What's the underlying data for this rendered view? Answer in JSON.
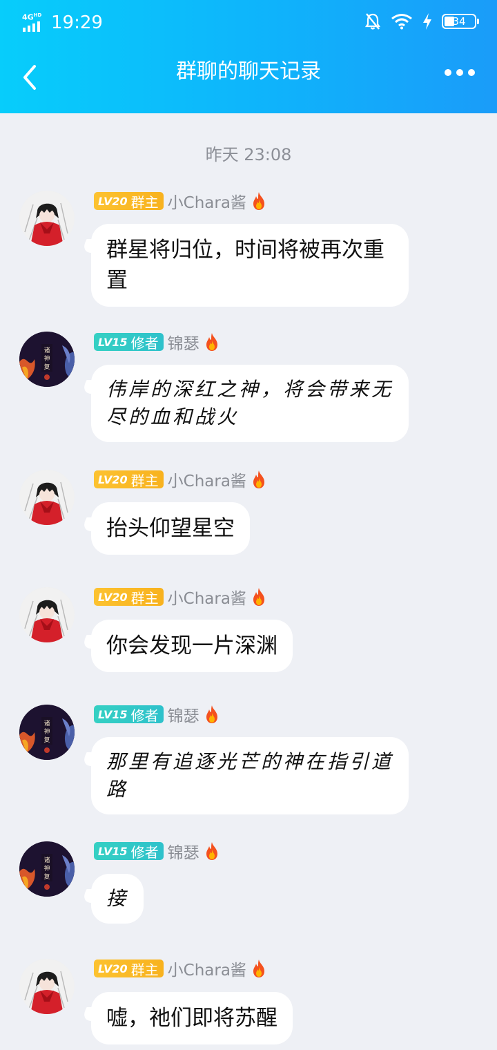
{
  "status_bar": {
    "network": "4G",
    "network_sup": "HD",
    "time": "19:29",
    "battery": "34"
  },
  "header": {
    "title": "群聊的聊天记录"
  },
  "timestamp": "昨天 23:08",
  "users": {
    "chara": {
      "level": "LV20",
      "role": "群主",
      "name": "小Chara酱"
    },
    "jinse": {
      "level": "LV15",
      "role": "修者",
      "name": "锦瑟"
    }
  },
  "messages": [
    {
      "user": "chara",
      "text": "群星将归位，时间将被再次重置"
    },
    {
      "user": "jinse",
      "text": "伟岸的深红之神，将会带来无尽的血和战火"
    },
    {
      "user": "chara",
      "text": "抬头仰望星空"
    },
    {
      "user": "chara",
      "text": "你会发现一片深渊"
    },
    {
      "user": "jinse",
      "text": "那里有追逐光芒的神在指引道路"
    },
    {
      "user": "jinse",
      "text": "接"
    },
    {
      "user": "chara",
      "text": "嘘，祂们即将苏醒"
    }
  ],
  "colors": {
    "header_start": "#07cdfb",
    "header_end": "#1a9cf9",
    "owner_badge": "#fcc230",
    "cultivator_badge": "#35d0c3",
    "background": "#eef0f5"
  },
  "icons": [
    "back-arrow-icon",
    "more-dots-icon",
    "mute-bell-icon",
    "wifi-icon",
    "charging-icon",
    "fire-icon"
  ]
}
